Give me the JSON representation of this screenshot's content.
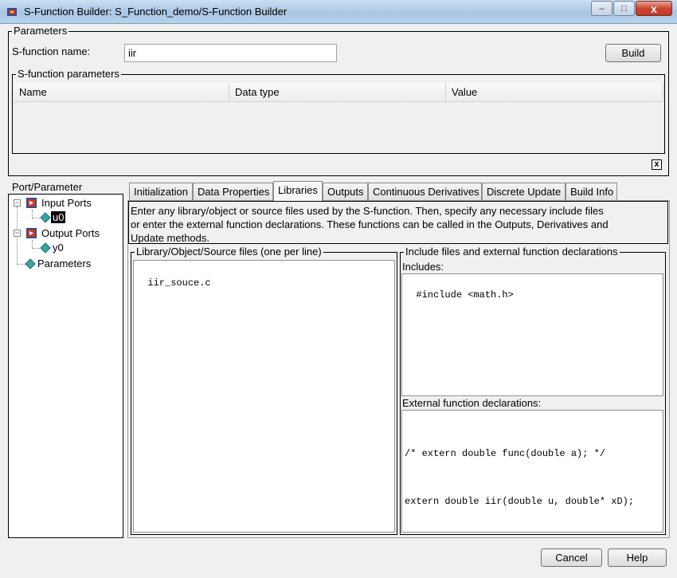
{
  "window": {
    "title": "S-Function Builder: S_Function_demo/S-Function Builder",
    "close_label": "x",
    "maximize_label": "□",
    "minimize_label": "–"
  },
  "parameters": {
    "legend": "Parameters",
    "sfunction_name_label": "S-function name:",
    "sfunction_name_value": "iir",
    "build_label": "Build",
    "sfunction_parameters_legend": "S-function parameters",
    "columns": [
      "Name",
      "Data type",
      "Value"
    ],
    "delete_label": "x"
  },
  "port_parameter": {
    "legend": "Port/Parameter",
    "input_ports": "Input Ports",
    "input_port_item": "u0",
    "output_ports": "Output Ports",
    "output_port_item": "y0",
    "parameters": "Parameters"
  },
  "tabs": [
    "Initialization",
    "Data Properties",
    "Libraries",
    "Outputs",
    "Continuous Derivatives",
    "Discrete Update",
    "Build Info"
  ],
  "active_tab": "Libraries",
  "description": {
    "line1": "Enter any library/object or source files used by the S-function. Then, specify any necessary include files",
    "line2": "or enter the external function declarations. These functions can be called in the Outputs, Derivatives and",
    "line3": "Update methods."
  },
  "libraries": {
    "legend": "Library/Object/Source files (one per line)",
    "content": "iir_souce.c"
  },
  "includes_group": {
    "legend": "Include files and external function declarations",
    "includes_label": "Includes:",
    "includes_content": "#include <math.h>",
    "external_label": "External function declarations:",
    "external_line1": "/* extern double func(double a); */",
    "external_line2": "extern double iir(double u, double* xD);"
  },
  "footer": {
    "cancel_label": "Cancel",
    "help_label": "Help"
  },
  "colors": {
    "titlebar": "#b9d2ea",
    "close": "#c9452f",
    "selection": "#000000"
  }
}
